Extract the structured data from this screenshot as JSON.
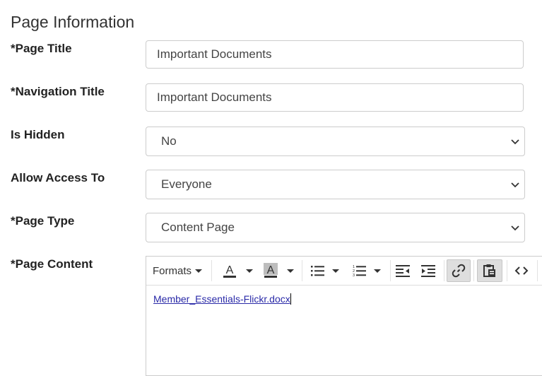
{
  "section": {
    "title": "Page Information"
  },
  "fields": {
    "page_title": {
      "label": "*Page Title",
      "value": "Important Documents"
    },
    "navigation_title": {
      "label": "*Navigation Title",
      "value": "Important Documents"
    },
    "is_hidden": {
      "label": "Is Hidden",
      "value": "No"
    },
    "allow_access_to": {
      "label": "Allow Access To",
      "value": "Everyone"
    },
    "page_type": {
      "label": "*Page Type",
      "value": "Content Page"
    },
    "page_content": {
      "label": "*Page Content"
    }
  },
  "editor": {
    "toolbar": {
      "formats_label": "Formats",
      "icons": [
        "text-color-icon",
        "background-color-icon",
        "bullet-list-icon",
        "numbered-list-icon",
        "outdent-icon",
        "indent-icon",
        "link-icon",
        "paste-icon",
        "source-code-icon"
      ]
    },
    "content_link": "Member_Essentials-Flickr.docx"
  },
  "colors": {
    "link": "#2a2aa8",
    "border": "#cccccc",
    "active_button": "#dedede"
  }
}
